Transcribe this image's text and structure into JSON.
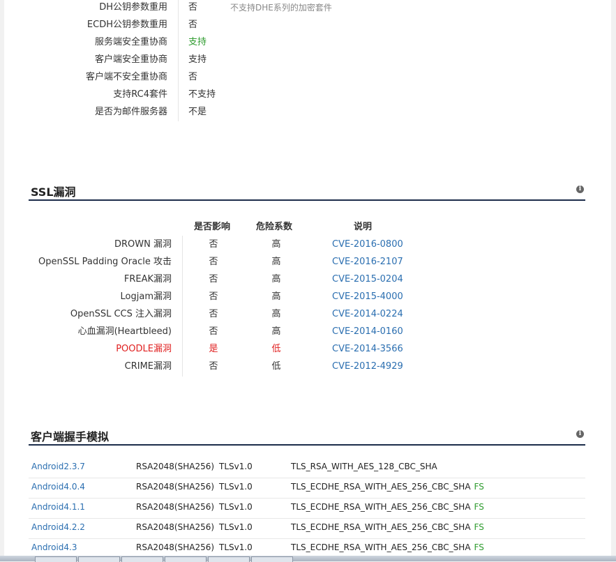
{
  "protocol_details": [
    {
      "label": "DH公钥参数重用",
      "value": "否",
      "value_color": "",
      "note": "不支持DHE系列的加密套件"
    },
    {
      "label": "ECDH公钥参数重用",
      "value": "否",
      "value_color": "",
      "note": ""
    },
    {
      "label": "服务端安全重协商",
      "value": "支持",
      "value_color": "#2e9b2e",
      "note": ""
    },
    {
      "label": "客户端安全重协商",
      "value": "支持",
      "value_color": "",
      "note": ""
    },
    {
      "label": "客户端不安全重协商",
      "value": "否",
      "value_color": "",
      "note": ""
    },
    {
      "label": "支持RC4套件",
      "value": "不支持",
      "value_color": "",
      "note": ""
    },
    {
      "label": "是否为邮件服务器",
      "value": "不是",
      "value_color": "",
      "note": ""
    }
  ],
  "vuln_section": {
    "title": "SSL漏洞",
    "headers": {
      "affected": "是否影响",
      "risk": "危险系数",
      "desc": "说明"
    },
    "rows": [
      {
        "name": "DROWN 漏洞",
        "affected": "否",
        "risk": "高",
        "cve": "CVE-2016-0800",
        "highlight": false
      },
      {
        "name": "OpenSSL Padding Oracle 攻击",
        "affected": "否",
        "risk": "高",
        "cve": "CVE-2016-2107",
        "highlight": false
      },
      {
        "name": "FREAK漏洞",
        "affected": "否",
        "risk": "高",
        "cve": "CVE-2015-0204",
        "highlight": false
      },
      {
        "name": "Logjam漏洞",
        "affected": "否",
        "risk": "高",
        "cve": "CVE-2015-4000",
        "highlight": false
      },
      {
        "name": "OpenSSL CCS 注入漏洞",
        "affected": "否",
        "risk": "高",
        "cve": "CVE-2014-0224",
        "highlight": false
      },
      {
        "name": "心血漏洞(Heartbleed)",
        "affected": "否",
        "risk": "高",
        "cve": "CVE-2014-0160",
        "highlight": false
      },
      {
        "name": "POODLE漏洞",
        "affected": "是",
        "risk": "低",
        "cve": "CVE-2014-3566",
        "highlight": true
      },
      {
        "name": "CRIME漏洞",
        "affected": "否",
        "risk": "低",
        "cve": "CVE-2012-4929",
        "highlight": false
      }
    ]
  },
  "handshake_section": {
    "title": "客户端握手模拟",
    "rows": [
      {
        "client": "Android2.3.7",
        "key": "RSA2048(SHA256)",
        "protocol": "TLSv1.0",
        "cipher": "TLS_RSA_WITH_AES_128_CBC_SHA",
        "fs": ""
      },
      {
        "client": "Android4.0.4",
        "key": "RSA2048(SHA256)",
        "protocol": "TLSv1.0",
        "cipher": "TLS_ECDHE_RSA_WITH_AES_256_CBC_SHA",
        "fs": "FS"
      },
      {
        "client": "Android4.1.1",
        "key": "RSA2048(SHA256)",
        "protocol": "TLSv1.0",
        "cipher": "TLS_ECDHE_RSA_WITH_AES_256_CBC_SHA",
        "fs": "FS"
      },
      {
        "client": "Android4.2.2",
        "key": "RSA2048(SHA256)",
        "protocol": "TLSv1.0",
        "cipher": "TLS_ECDHE_RSA_WITH_AES_256_CBC_SHA",
        "fs": "FS"
      },
      {
        "client": "Android4.3",
        "key": "RSA2048(SHA256)",
        "protocol": "TLSv1.0",
        "cipher": "TLS_ECDHE_RSA_WITH_AES_256_CBC_SHA",
        "fs": "FS"
      }
    ]
  },
  "colors": {
    "link": "#2a6eb0",
    "green": "#2e9b2e",
    "red": "#e02020",
    "section_rule": "#1c2c4a"
  },
  "icons": {
    "section_info": "info-icon"
  }
}
